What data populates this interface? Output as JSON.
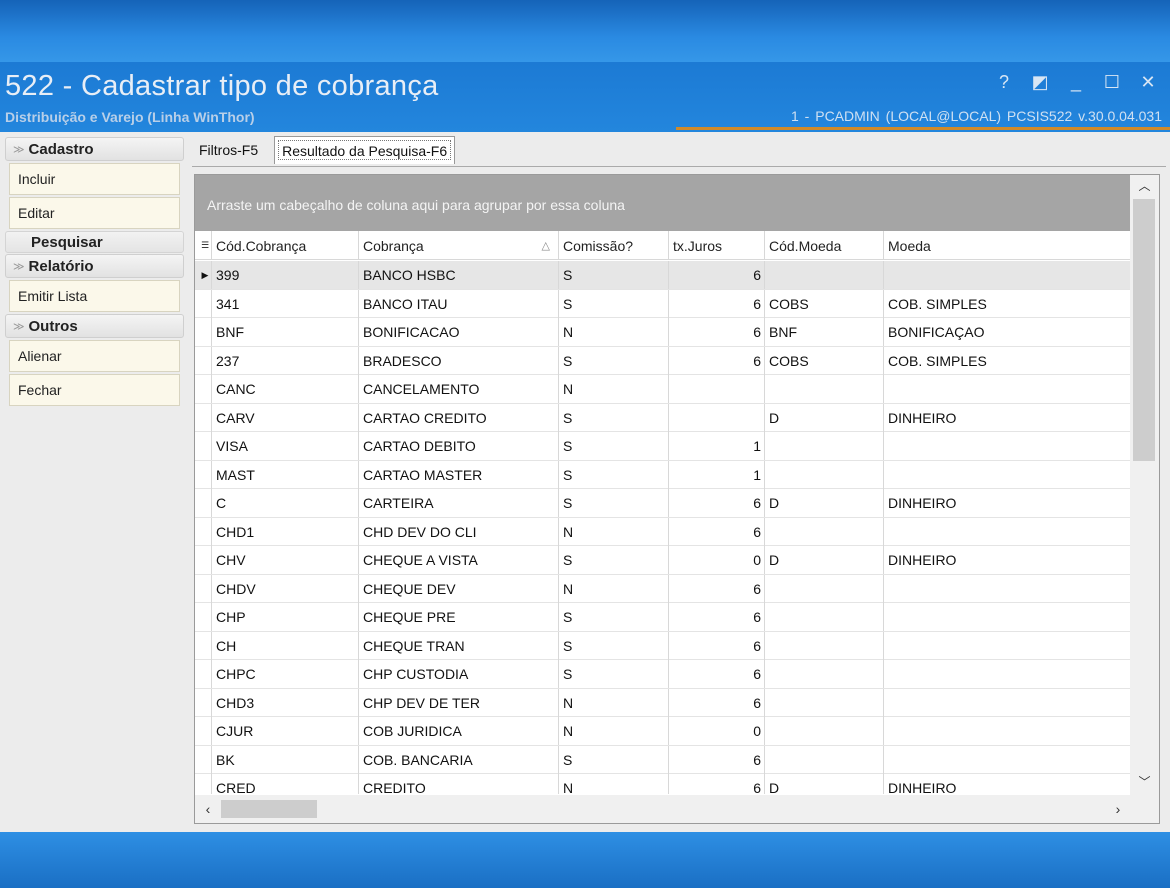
{
  "window": {
    "title": "522 - Cadastrar tipo de cobrança",
    "subtitle": "Distribuição e Varejo (Linha WinThor)",
    "user_info": "1 - PCADMIN (LOCAL@LOCAL)   PCSIS522  v.30.0.04.031",
    "controls": {
      "help": "?",
      "restore_icon": "◩",
      "minimize": "_",
      "maximize": "☐",
      "close": "✕"
    }
  },
  "sidebar": {
    "cadastro": {
      "label": "Cadastro",
      "items": [
        "Incluir",
        "Editar"
      ]
    },
    "pesquisar": "Pesquisar",
    "relatorio": {
      "label": "Relatório",
      "items": [
        "Emitir Lista"
      ]
    },
    "outros": {
      "label": "Outros",
      "items": [
        "Alienar",
        "Fechar"
      ]
    }
  },
  "tabs": [
    "Filtros-F5",
    "Resultado da Pesquisa-F6"
  ],
  "grid": {
    "group_hint": "Arraste um cabeçalho de coluna aqui para agrupar por essa coluna",
    "columns": [
      "Cód.Cobrança",
      "Cobrança",
      "Comissão?",
      "tx.Juros",
      "Cód.Moeda",
      "Moeda"
    ],
    "rows": [
      [
        "399",
        "BANCO HSBC",
        "S",
        "6",
        "",
        ""
      ],
      [
        "341",
        "BANCO ITAU",
        "S",
        "6",
        "COBS",
        "COB. SIMPLES"
      ],
      [
        "BNF",
        "BONIFICACAO",
        "N",
        "6",
        "BNF",
        "BONIFICAÇAO"
      ],
      [
        "237",
        "BRADESCO",
        "S",
        "6",
        "COBS",
        "COB. SIMPLES"
      ],
      [
        "CANC",
        "CANCELAMENTO",
        "N",
        "",
        "",
        ""
      ],
      [
        "CARV",
        "CARTAO CREDITO",
        "S",
        "",
        "D",
        "DINHEIRO"
      ],
      [
        "VISA",
        "CARTAO DEBITO",
        "S",
        "1",
        "",
        ""
      ],
      [
        "MAST",
        "CARTAO MASTER",
        "S",
        "1",
        "",
        ""
      ],
      [
        "C",
        "CARTEIRA",
        "S",
        "6",
        "D",
        "DINHEIRO"
      ],
      [
        "CHD1",
        "CHD DEV DO CLI",
        "N",
        "6",
        "",
        ""
      ],
      [
        "CHV",
        "CHEQUE A VISTA",
        "S",
        "0",
        "D",
        "DINHEIRO"
      ],
      [
        "CHDV",
        "CHEQUE DEV",
        "N",
        "6",
        "",
        ""
      ],
      [
        "CHP",
        "CHEQUE PRE",
        "S",
        "6",
        "",
        ""
      ],
      [
        "CH",
        "CHEQUE TRAN",
        "S",
        "6",
        "",
        ""
      ],
      [
        "CHPC",
        "CHP CUSTODIA",
        "S",
        "6",
        "",
        ""
      ],
      [
        "CHD3",
        "CHP DEV DE TER",
        "N",
        "6",
        "",
        ""
      ],
      [
        "CJUR",
        "COB JURIDICA",
        "N",
        "0",
        "",
        ""
      ],
      [
        "BK",
        "COB. BANCARIA",
        "S",
        "6",
        "",
        ""
      ],
      [
        "CRED",
        "CREDITO",
        "N",
        "6",
        "D",
        "DINHEIRO"
      ]
    ]
  },
  "colors": {
    "title_bar": "#1f7ed6",
    "group_panel": "#a5a5a5",
    "button_bg": "#fbf8ea",
    "accent_line": "#d08a2a"
  }
}
